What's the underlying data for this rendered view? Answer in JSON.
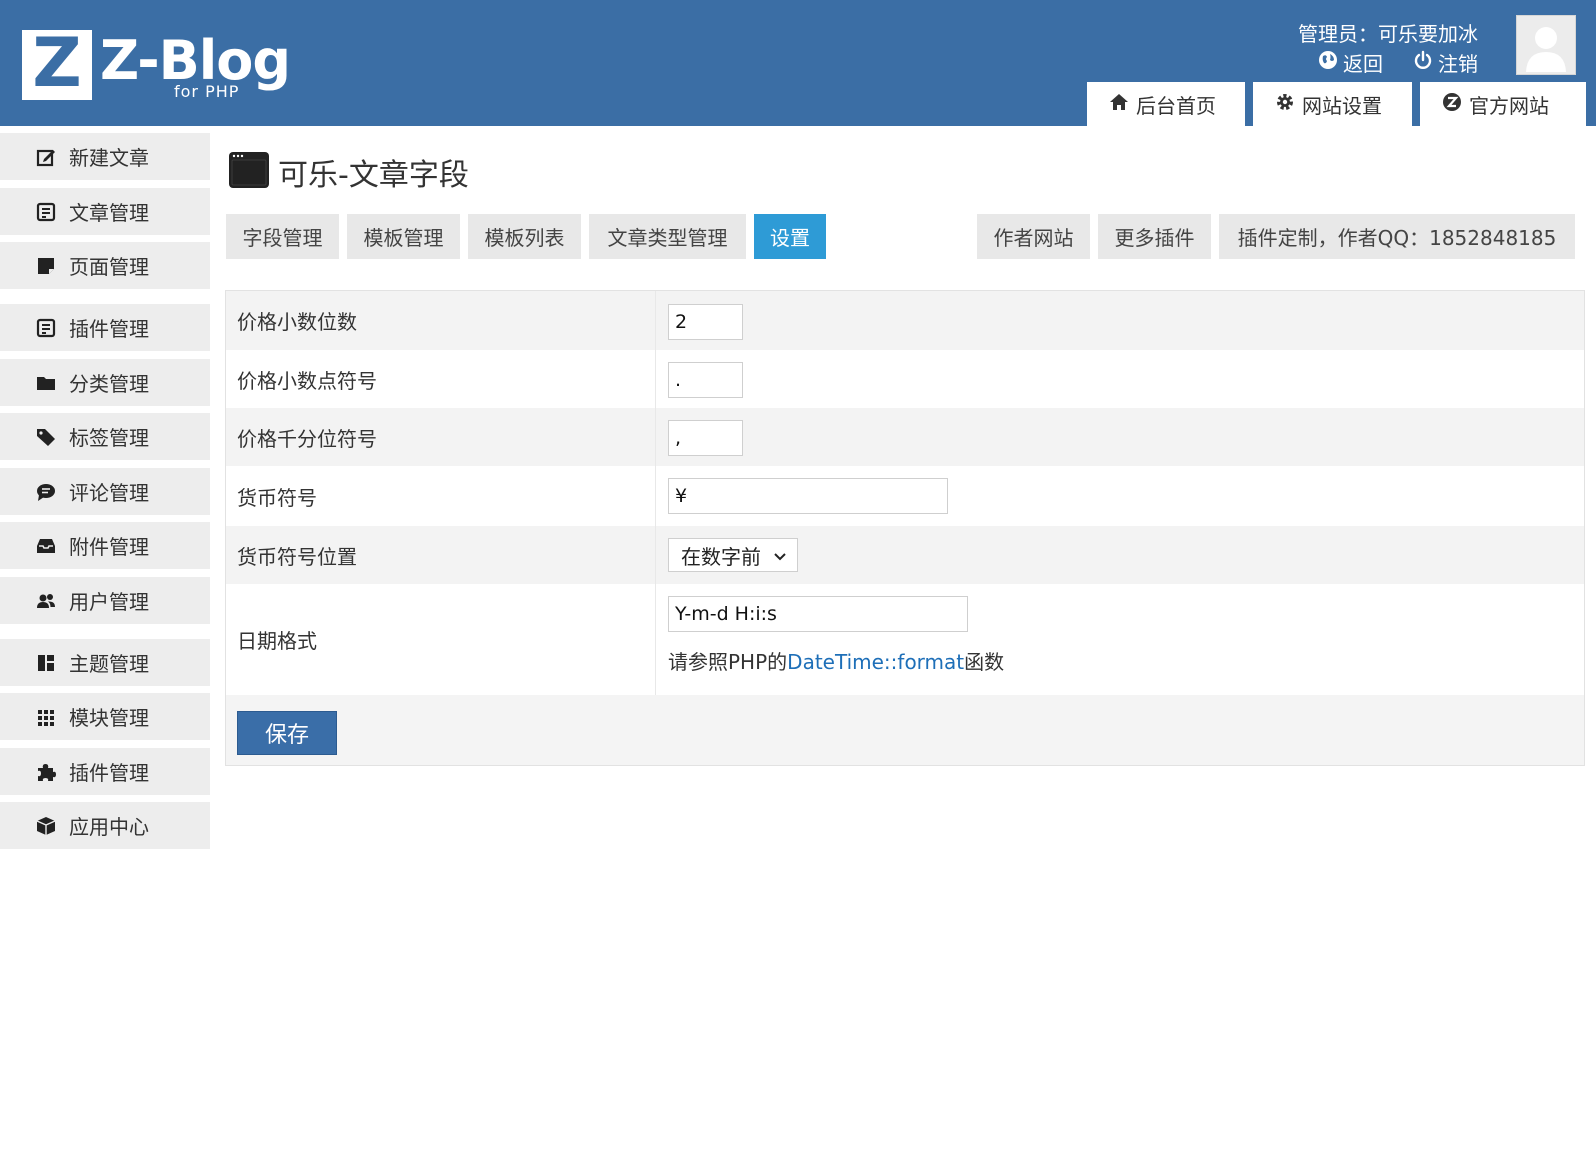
{
  "header": {
    "logo_letter": "Z",
    "logo_text": "Z-Blog",
    "logo_sub": "for PHP",
    "admin_label": "管理员：可乐要加冰",
    "back_label": "返回",
    "logout_label": "注销",
    "tabs": [
      {
        "label": "后台首页",
        "icon": "home-icon"
      },
      {
        "label": "网站设置",
        "icon": "gear-icon"
      },
      {
        "label": "官方网站",
        "icon": "zblog-icon"
      }
    ]
  },
  "sidebar": {
    "items": [
      {
        "label": "新建文章",
        "icon": "edit-icon"
      },
      {
        "label": "文章管理",
        "icon": "article-list-icon"
      },
      {
        "label": "页面管理",
        "icon": "page-icon"
      },
      {
        "label": "插件管理",
        "icon": "article-list-icon"
      },
      {
        "label": "分类管理",
        "icon": "folder-icon"
      },
      {
        "label": "标签管理",
        "icon": "tag-icon"
      },
      {
        "label": "评论管理",
        "icon": "comment-icon"
      },
      {
        "label": "附件管理",
        "icon": "inbox-icon"
      },
      {
        "label": "用户管理",
        "icon": "users-icon"
      },
      {
        "label": "主题管理",
        "icon": "layout-icon"
      },
      {
        "label": "模块管理",
        "icon": "grid-icon"
      },
      {
        "label": "插件管理",
        "icon": "puzzle-icon"
      },
      {
        "label": "应用中心",
        "icon": "box-icon"
      }
    ]
  },
  "page": {
    "title": "可乐-文章字段",
    "tabs_left": [
      {
        "label": "字段管理",
        "active": false
      },
      {
        "label": "模板管理",
        "active": false
      },
      {
        "label": "模板列表",
        "active": false
      },
      {
        "label": "文章类型管理",
        "active": false
      },
      {
        "label": "设置",
        "active": true
      }
    ],
    "tabs_right": [
      {
        "label": "作者网站"
      },
      {
        "label": "更多插件"
      },
      {
        "label": "插件定制，作者QQ：1852848185"
      }
    ]
  },
  "form": {
    "rows": [
      {
        "label": "价格小数位数",
        "value": "2"
      },
      {
        "label": "价格小数点符号",
        "value": "."
      },
      {
        "label": "价格千分位符号",
        "value": ","
      },
      {
        "label": "货币符号",
        "value": "¥"
      },
      {
        "label": "货币符号位置",
        "value": "在数字前"
      },
      {
        "label": "日期格式",
        "value": "Y-m-d H:i:s"
      }
    ],
    "help_prefix": "请参照PHP的",
    "help_link": "DateTime::format",
    "help_suffix": "函数",
    "save_label": "保存"
  },
  "colors": {
    "header_bg": "#3b6ea5",
    "active_tab": "#2e9bd6",
    "save_button": "#3a6ea8",
    "link": "#1e6fb8"
  }
}
